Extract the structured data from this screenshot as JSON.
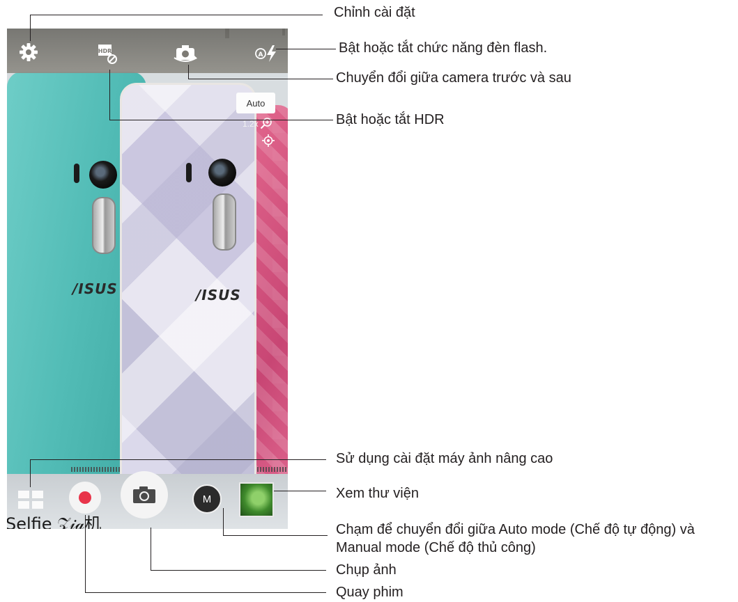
{
  "screen": {
    "top_bar": {
      "settings_icon": "gear-icon",
      "hdr_icon": "hdr-off-icon",
      "hdr_glyph": "HDR",
      "switch_camera_icon": "camera-switch-icon",
      "flash_icon": "flash-auto-icon"
    },
    "auto_chip": "Auto",
    "zoom_level": "1.2x",
    "preview": {
      "brand_logo": "/ISUS",
      "selfie_caption": "Selfie 𝒵𝒾𝒶机"
    },
    "bottom_bar": {
      "modes_icon": "grid-icon",
      "record_icon": "record-dot-icon",
      "shutter_icon": "camera-icon",
      "mode_button_label": "M",
      "gallery_icon": "gallery-thumbnail"
    }
  },
  "callouts": {
    "settings": "Chỉnh cài đặt",
    "flash": "Bật hoặc tắt chức năng đèn flash.",
    "switch_camera": "Chuyển đổi giữa camera trước và sau",
    "hdr": "Bật hoặc tắt HDR",
    "advanced_settings": "Sử dụng cài đặt máy ảnh nâng cao",
    "gallery": "Xem thư viện",
    "mode_line1": "Chạm để chuyển đổi giữa Auto mode (Chế độ tự động) và",
    "mode_line2": "Manual mode (Chế độ thủ công)",
    "take_photo": "Chụp ảnh",
    "record_video": "Quay phim"
  },
  "colors": {
    "record_red": "#e8344a",
    "teal_phone": "#52bcb6",
    "pink_phone": "#c84674",
    "callout_line": "#231f20"
  }
}
